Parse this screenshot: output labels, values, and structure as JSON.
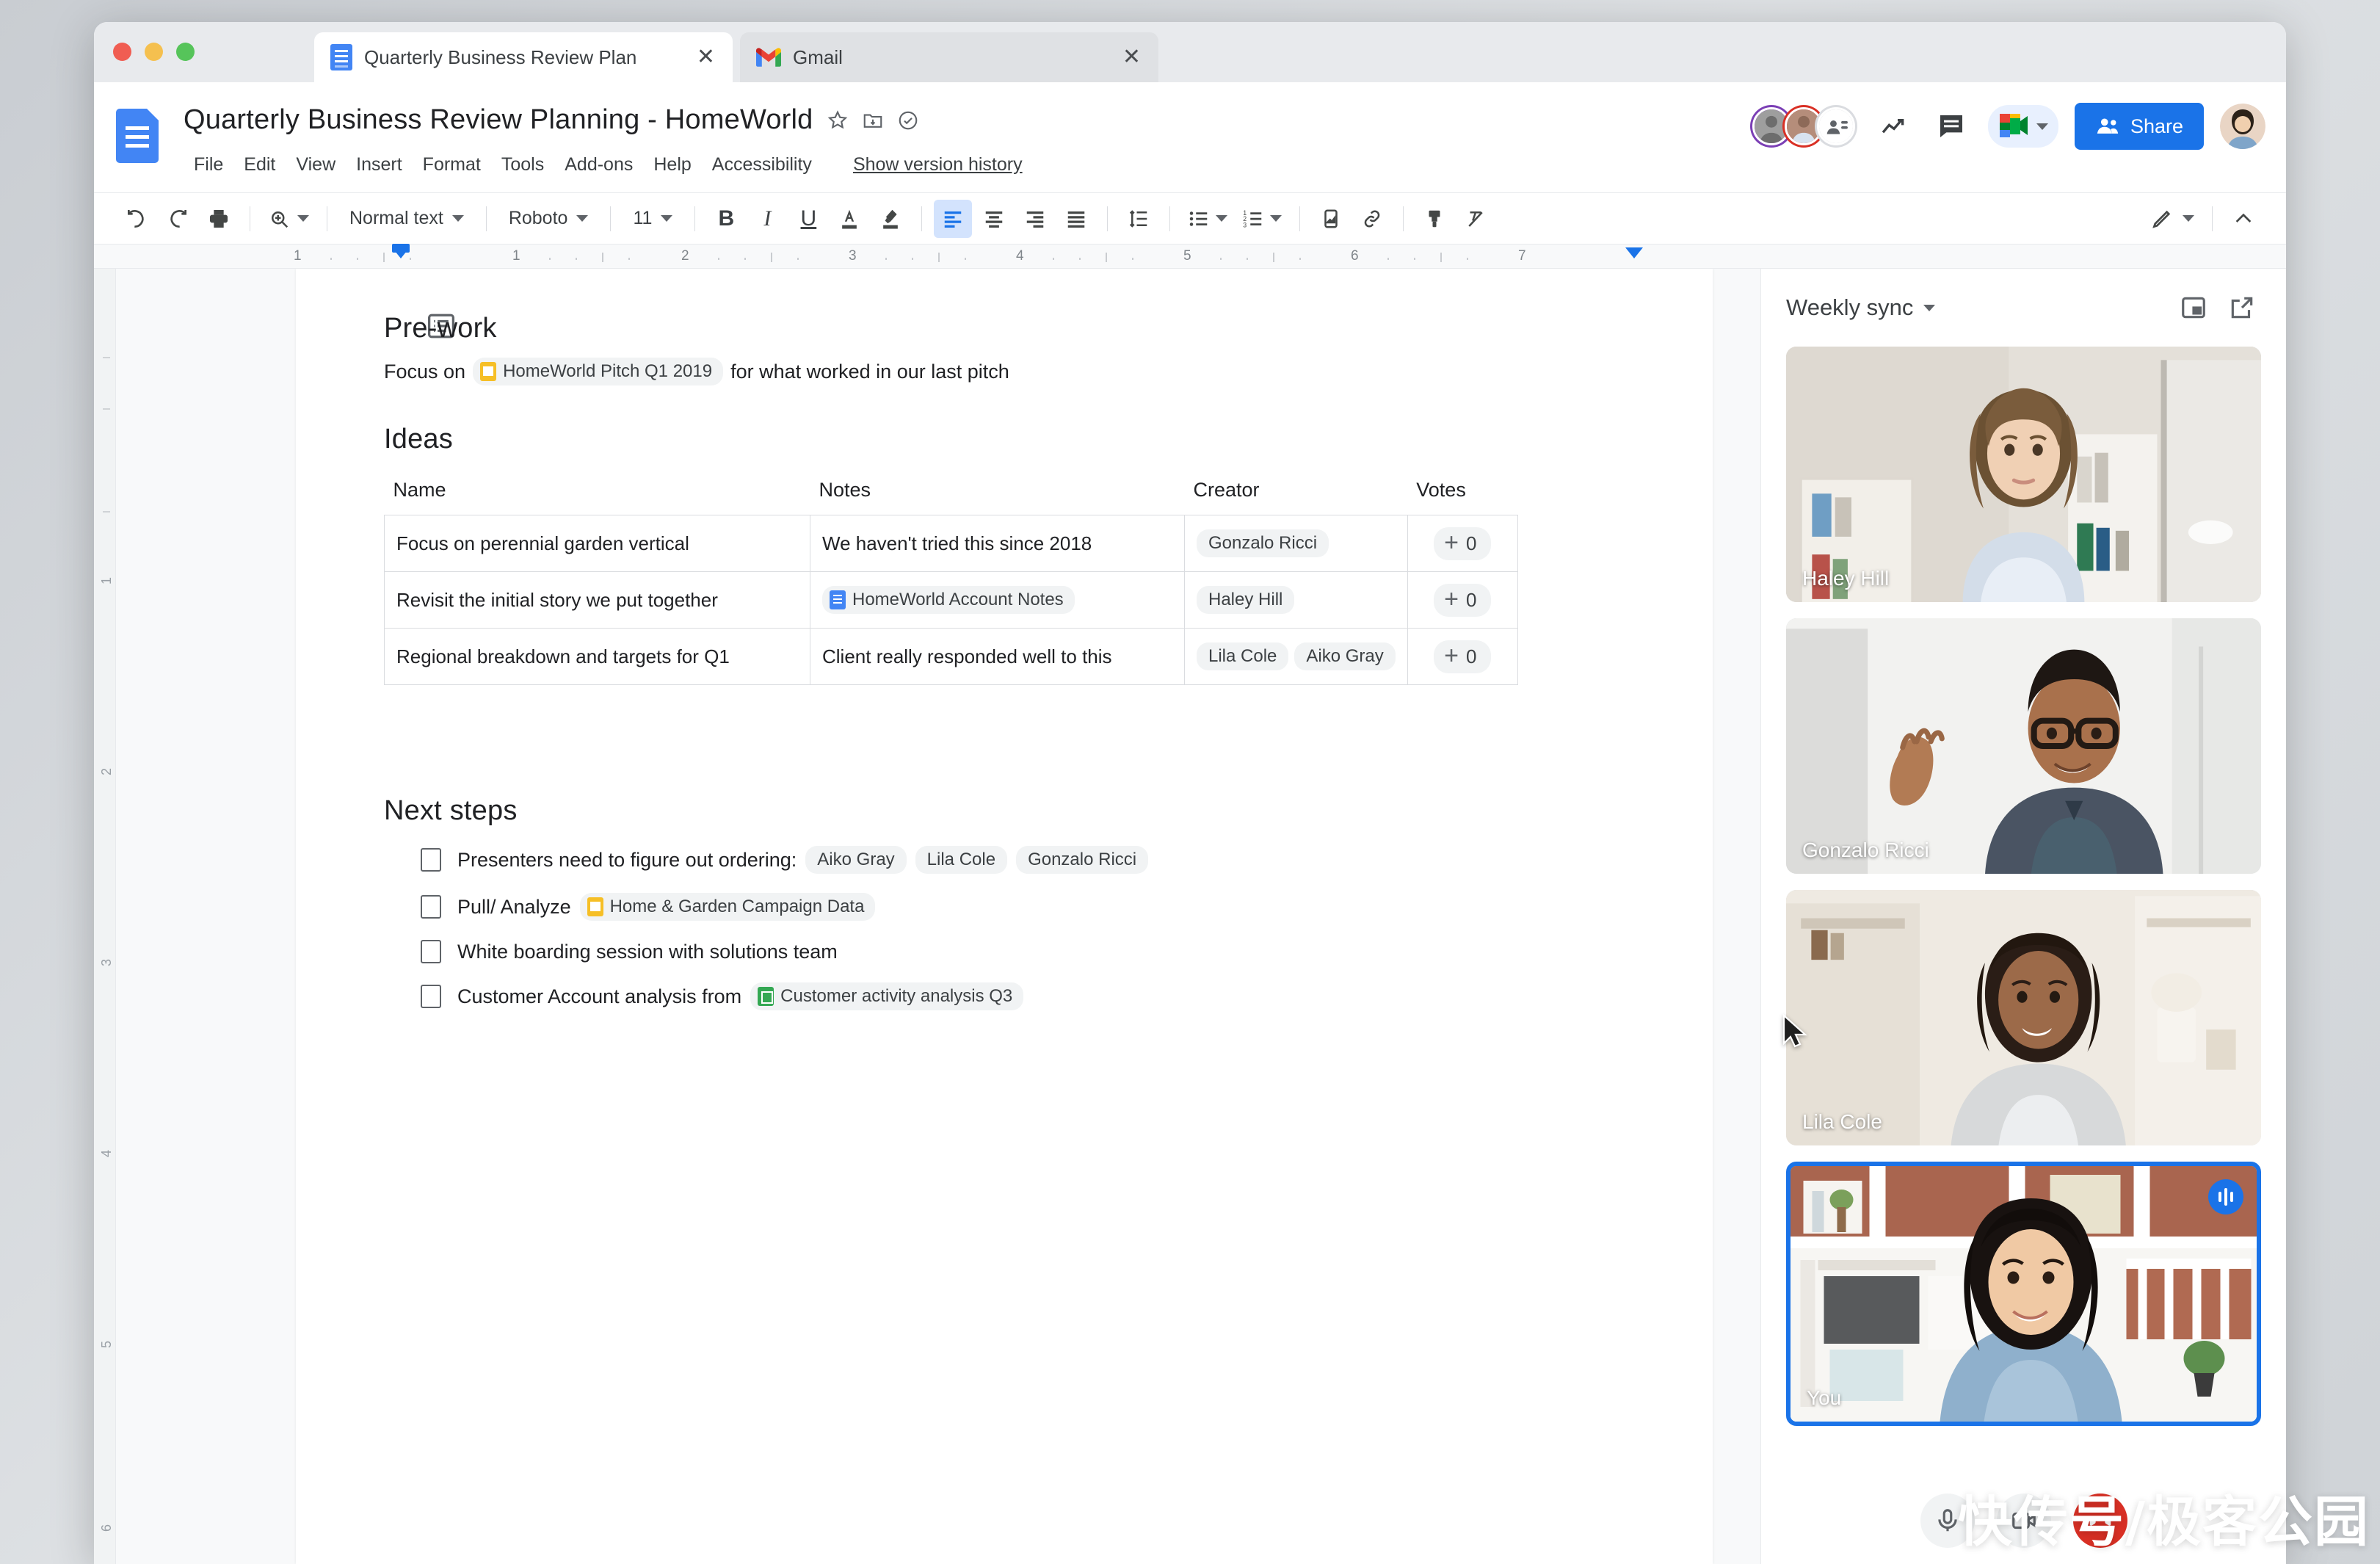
{
  "window": {
    "traffic_lights": [
      "close",
      "minimize",
      "maximize"
    ],
    "tabs": [
      {
        "title": "Quarterly Business Review Plan",
        "favicon": "docs-icon",
        "active": true,
        "close": "✕"
      },
      {
        "title": "Gmail",
        "favicon": "gmail-icon",
        "active": false,
        "close": "✕"
      }
    ]
  },
  "docs": {
    "title": "Quarterly Business Review Planning - HomeWorld",
    "title_icons": [
      "star-icon",
      "move-to-folder-icon",
      "cloud-saved-icon"
    ],
    "menus": [
      "File",
      "Edit",
      "View",
      "Insert",
      "Format",
      "Tools",
      "Add-ons",
      "Help",
      "Accessibility"
    ],
    "version_history_link": "Show version history",
    "header_actions": {
      "trending_icon": "activity-dashboard-icon",
      "comment_icon": "comments-icon",
      "meet_label": "meet-icon",
      "share_label": "Share"
    },
    "toolbar": {
      "undo": "undo-icon",
      "redo": "redo-icon",
      "print": "print-icon",
      "zoom": "zoom-icon",
      "style": "Normal text",
      "font": "Roboto",
      "size": "11",
      "bold": "B",
      "italic": "I",
      "underline": "U",
      "text_color": "text-color-icon",
      "highlight": "highlight-icon",
      "align_left": "align-left-icon",
      "align_center": "align-center-icon",
      "align_right": "align-right-icon",
      "align_justify": "align-justify-icon",
      "line_spacing": "line-spacing-icon",
      "bulleted_list": "bulleted-list-icon",
      "numbered_list": "numbered-list-icon",
      "insert_image": "insert-image-icon",
      "insert_link": "insert-link-icon",
      "paint_format": "paint-format-icon",
      "clear_format": "clear-formatting-icon",
      "edit_mode": "pencil-icon",
      "collapse": "collapse-chevron-icon",
      "active_tool": "align_left"
    },
    "ruler": {
      "numbers": [
        "1",
        "1",
        "2",
        "3",
        "4",
        "5",
        "6",
        "7"
      ]
    },
    "vruler": {
      "numbers": [
        "1",
        "2",
        "3",
        "4",
        "5",
        "6"
      ]
    }
  },
  "document": {
    "prework": {
      "heading": "Pre-work",
      "text_before": "Focus on",
      "chip": {
        "label": "HomeWorld Pitch Q1 2019",
        "type": "slides"
      },
      "text_after": "for what worked in our last pitch"
    },
    "ideas": {
      "heading": "Ideas",
      "columns": [
        "Name",
        "Notes",
        "Creator",
        "Votes"
      ],
      "rows": [
        {
          "name": "Focus on perennial garden vertical",
          "notes": "We haven't tried this since 2018",
          "notes_chip": null,
          "creators": [
            "Gonzalo Ricci"
          ],
          "votes": "0"
        },
        {
          "name": "Revisit the initial story we put together",
          "notes": "",
          "notes_chip": {
            "label": "HomeWorld Account Notes",
            "type": "docs"
          },
          "creators": [
            "Haley Hill"
          ],
          "votes": "0"
        },
        {
          "name": "Regional breakdown and targets for Q1",
          "notes": "Client really responded well to this",
          "notes_chip": null,
          "creators": [
            "Lila Cole",
            "Aiko Gray"
          ],
          "votes": "0"
        }
      ]
    },
    "next_steps": {
      "heading": "Next steps",
      "items": [
        {
          "text": "Presenters need to figure out ordering:",
          "people": [
            "Aiko Gray",
            "Lila Cole",
            "Gonzalo Ricci"
          ],
          "chip": null,
          "checked": false
        },
        {
          "text": "Pull/ Analyze",
          "people": [],
          "chip": {
            "label": "Home & Garden Campaign Data",
            "type": "slides"
          },
          "checked": false
        },
        {
          "text": "White boarding session with solutions team",
          "people": [],
          "chip": null,
          "checked": false
        },
        {
          "text": "Customer Account analysis from",
          "people": [],
          "chip": {
            "label": "Customer activity analysis Q3",
            "type": "sheets"
          },
          "checked": false
        }
      ]
    }
  },
  "meet": {
    "title": "Weekly sync",
    "dropdown_icon": "chevron-down-icon",
    "pip_icon": "picture-in-picture-icon",
    "popout_icon": "open-in-new-icon",
    "participants": [
      {
        "name": "Haley Hill",
        "active": false,
        "speaking": false
      },
      {
        "name": "Gonzalo Ricci",
        "active": false,
        "speaking": false
      },
      {
        "name": "Lila Cole",
        "active": false,
        "speaking": false
      },
      {
        "name": "You",
        "active": true,
        "speaking": true
      }
    ],
    "controls": [
      "microphone-icon",
      "camera-icon",
      "end-call-icon"
    ]
  },
  "watermark": "快传号/极客公园",
  "colors": {
    "accent_blue": "#1a73e8",
    "docs_blue": "#4285f4",
    "sheets_green": "#34a853",
    "slides_yellow": "#f6bf26",
    "red": "#d93025"
  }
}
